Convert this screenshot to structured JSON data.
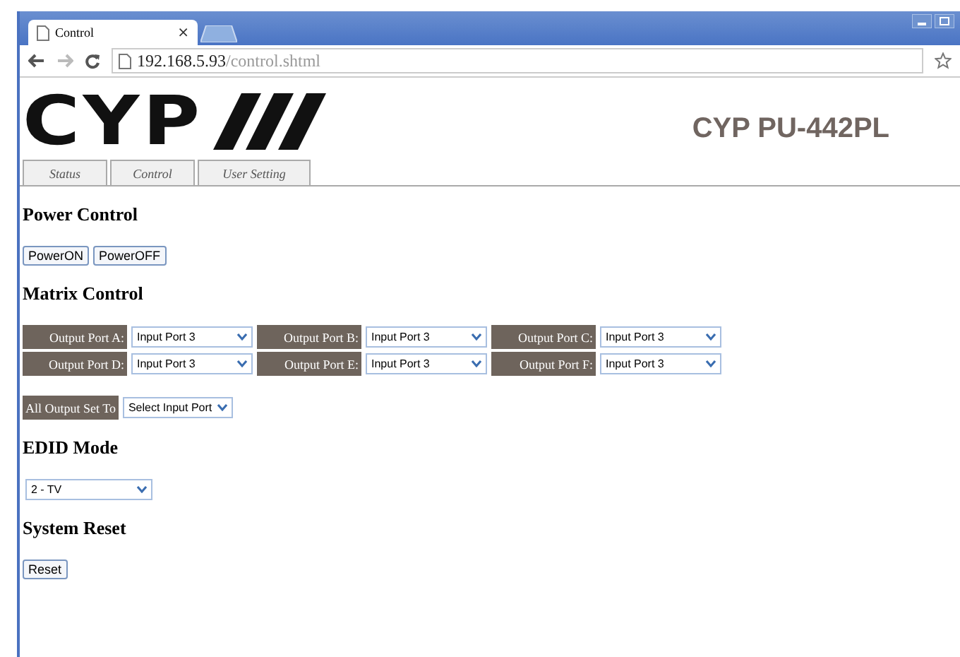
{
  "browser": {
    "tab_title": "Control",
    "tab_close": "×",
    "url_host": "192.168.5.93",
    "url_path": "/control.shtml"
  },
  "header": {
    "logo": "CYP",
    "model": "CYP PU-442PL"
  },
  "nav_tabs": [
    {
      "label": "Status",
      "selected": false
    },
    {
      "label": "Control",
      "selected": false
    },
    {
      "label": "User Setting",
      "selected": false
    }
  ],
  "power_control": {
    "heading": "Power Control",
    "buttons": [
      "PowerON",
      "PowerOFF"
    ]
  },
  "matrix_control": {
    "heading": "Matrix Control",
    "outputs": [
      {
        "label": "Output Port A:",
        "value": "Input Port 3"
      },
      {
        "label": "Output Port B:",
        "value": "Input Port 3"
      },
      {
        "label": "Output Port C:",
        "value": "Input Port 3"
      },
      {
        "label": "Output Port D:",
        "value": "Input Port 3"
      },
      {
        "label": "Output Port E:",
        "value": "Input Port 3"
      },
      {
        "label": "Output Port F:",
        "value": "Input Port 3"
      }
    ],
    "all_output": {
      "label": "All Output Set To",
      "value": "Select Input Port"
    }
  },
  "edid_mode": {
    "heading": "EDID Mode",
    "value": "2 - TV"
  },
  "system_reset": {
    "heading": "System Reset",
    "button": "Reset"
  }
}
